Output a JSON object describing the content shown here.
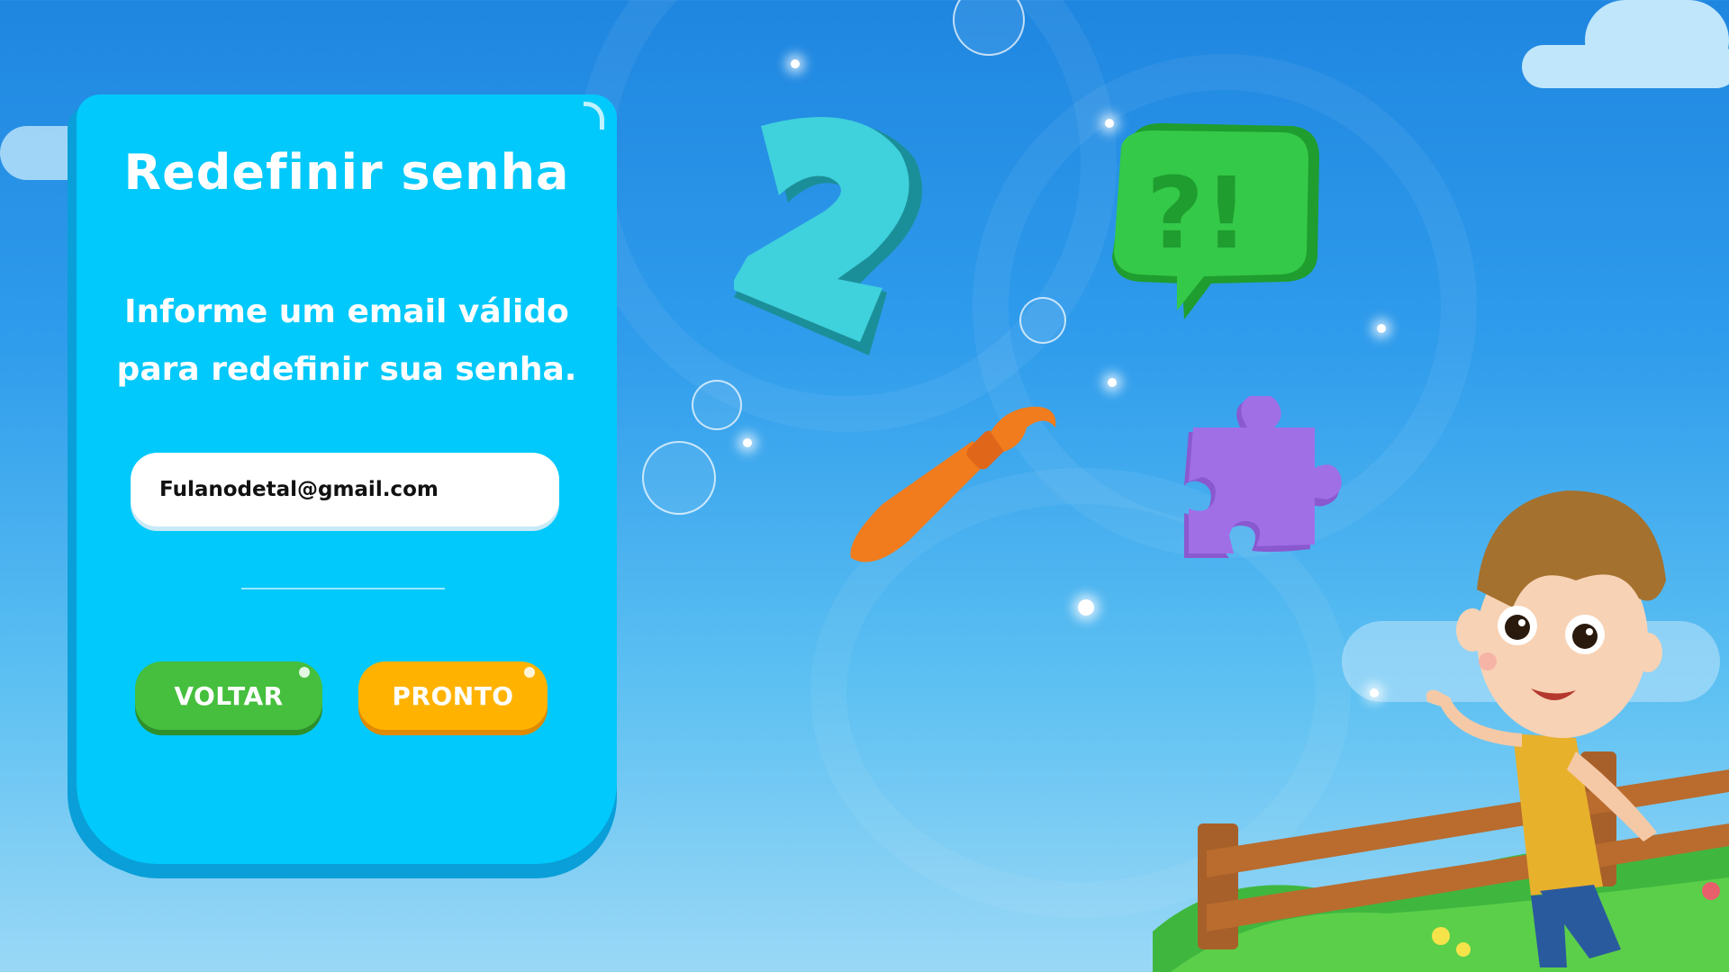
{
  "card": {
    "title": "Redefinir senha",
    "subtitle_line1": "Informe um email válido",
    "subtitle_line2": "para redefinir sua senha."
  },
  "email_field": {
    "value": "Fulanodetal@gmail.com"
  },
  "buttons": {
    "back_label": "VOLTAR",
    "done_label": "PRONTO"
  },
  "colors": {
    "card": "#02c9fb",
    "back_button": "#45bf3d",
    "done_button": "#ffb300"
  },
  "decorations": {
    "icons": [
      "number-two-icon",
      "speech-bubble-question-exclamation-icon",
      "paintbrush-icon",
      "puzzle-piece-icon"
    ],
    "character": "boy-waving-illustration"
  }
}
